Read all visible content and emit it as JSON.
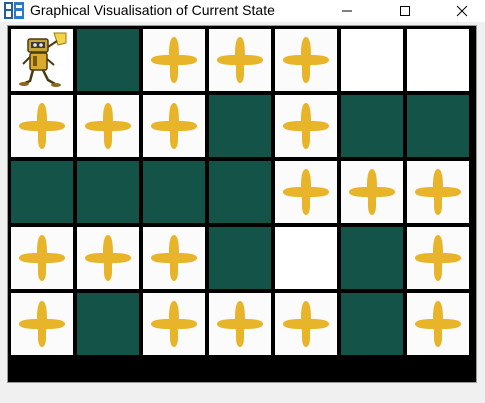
{
  "window": {
    "title": "Graphical Visualisation of Current State",
    "app_icon": "app-logo-icon",
    "controls": {
      "minimize_icon": "minimize-icon",
      "maximize_icon": "maximize-icon",
      "close_icon": "close-icon"
    }
  },
  "colors": {
    "wall": "#145448",
    "dirt": "#e8b52a",
    "empty": "#ffffff",
    "grid_lines": "#000000"
  },
  "grid": {
    "rows": 5,
    "cols": 7,
    "cells": [
      [
        "robot",
        "wall",
        "dirt",
        "dirt",
        "dirt",
        "empty",
        "empty"
      ],
      [
        "dirt",
        "dirt",
        "dirt",
        "wall",
        "dirt",
        "wall",
        "wall"
      ],
      [
        "wall",
        "wall",
        "wall",
        "wall",
        "dirt",
        "dirt",
        "dirt"
      ],
      [
        "dirt",
        "dirt",
        "dirt",
        "wall",
        "empty",
        "wall",
        "dirt"
      ],
      [
        "dirt",
        "wall",
        "dirt",
        "dirt",
        "dirt",
        "wall",
        "dirt"
      ]
    ]
  }
}
